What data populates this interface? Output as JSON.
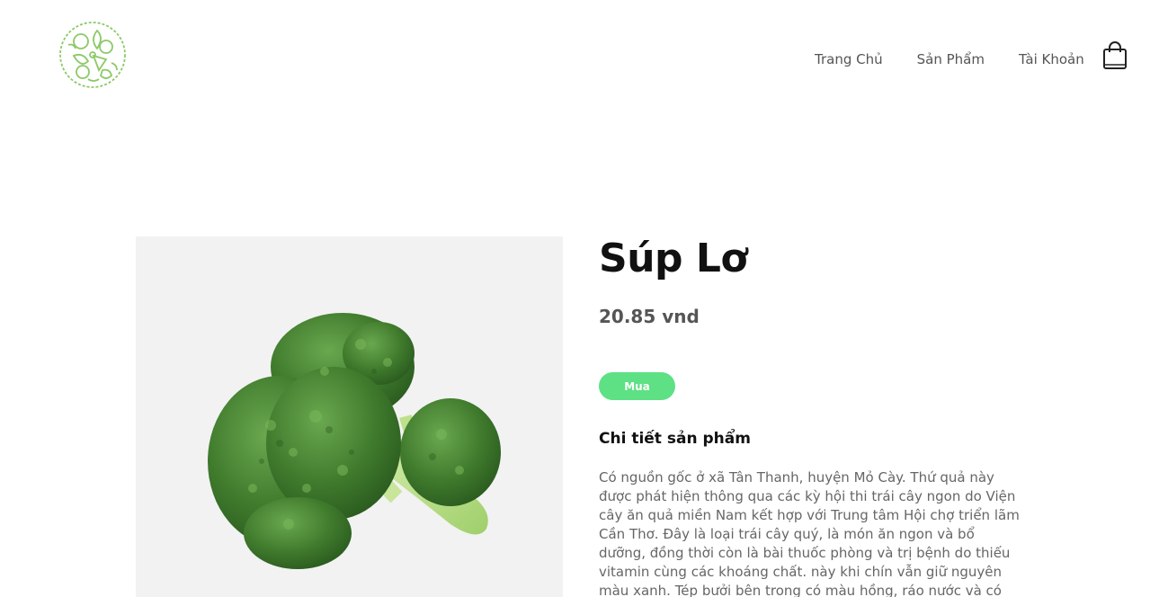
{
  "header": {
    "logo_icon": "vegetable-logo-icon",
    "nav": [
      {
        "label": "Trang Chủ"
      },
      {
        "label": "Sản Phẩm"
      },
      {
        "label": "Tài Khoản"
      }
    ],
    "cart_icon": "shopping-bag-icon"
  },
  "product": {
    "image_icon": "broccoli-image",
    "name": "Súp Lơ",
    "price": "20.85 vnd",
    "buy_label": "Mua",
    "detail_heading": "Chi tiết sản phẩm",
    "description": "Có nguồn gốc ở xã Tân Thanh, huyện Mỏ Cày. Thứ quả này được phát hiện thông qua các kỳ hội thi trái cây ngon do Viện cây ăn quả miền Nam kết hợp với Trung tâm Hội chợ triển lãm Cần Thơ. Đây là loại trái cây quý, là món ăn ngon và bổ dưỡng, đồng thời còn là bài thuốc phòng và trị bệnh do thiếu vitamin cùng các khoáng chất. này khi chín vẫn giữ nguyên màu xanh. Tép bưởi bên trong có màu hồng, ráo nước và có rất ít hoặc không có hạt. Múi"
  },
  "colors": {
    "accent": "#5de184",
    "logo": "#8cc968"
  }
}
